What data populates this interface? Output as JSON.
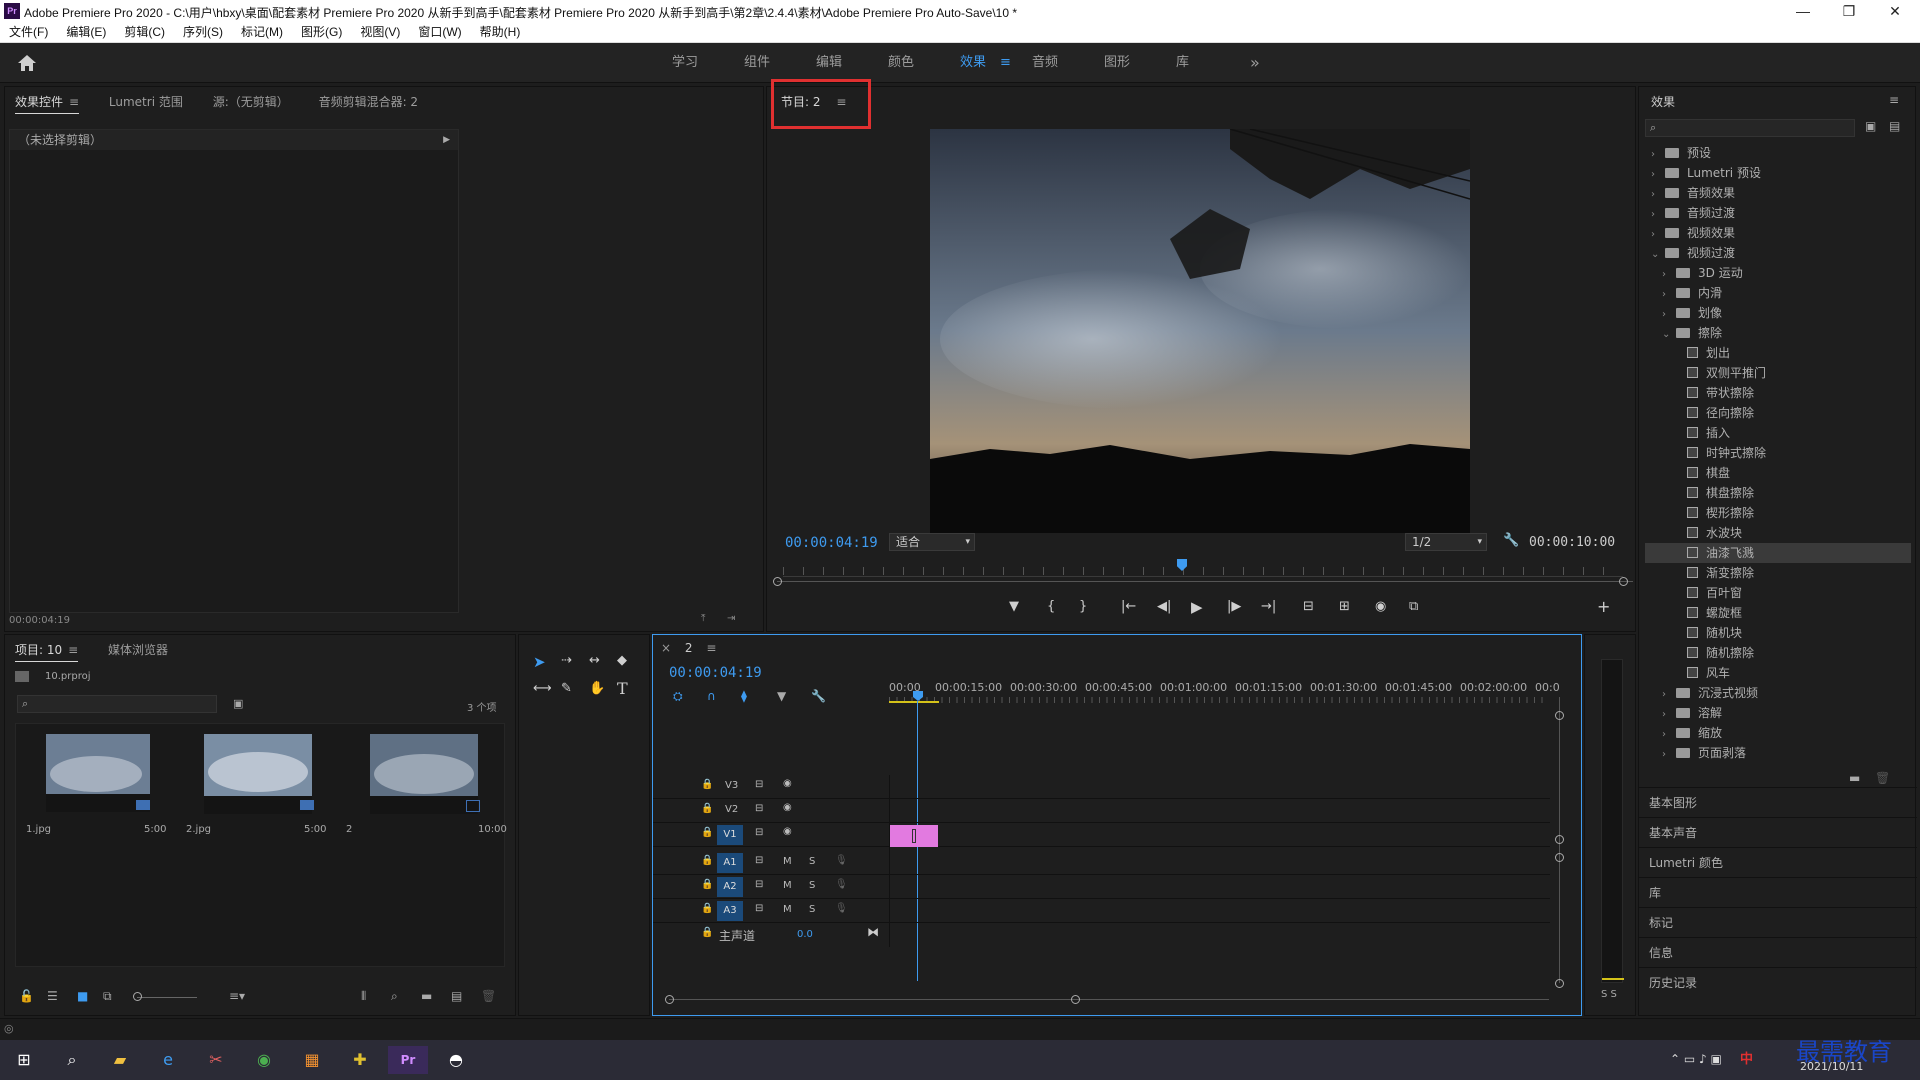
{
  "window": {
    "title": "Adobe Premiere Pro 2020 - C:\\用户\\hbxy\\桌面\\配套素材 Premiere Pro 2020 从新手到高手\\配套素材 Premiere Pro 2020 从新手到高手\\第2章\\2.4.4\\素材\\Adobe Premiere Pro Auto-Save\\10 *",
    "logo": "Pr",
    "minimize": "—",
    "maximize": "❐",
    "close": "✕"
  },
  "menu": [
    "文件(F)",
    "编辑(E)",
    "剪辑(C)",
    "序列(S)",
    "标记(M)",
    "图形(G)",
    "视图(V)",
    "窗口(W)",
    "帮助(H)"
  ],
  "workspaces": {
    "items": [
      "学习",
      "组件",
      "编辑",
      "颜色",
      "效果",
      "音频",
      "图形",
      "库"
    ],
    "active_index": 4,
    "menu_glyph": "≡",
    "more": "»"
  },
  "source_panel": {
    "tabs": [
      "效果控件",
      "Lumetri 范围",
      "源:（无剪辑）",
      "音频剪辑混合器: 2"
    ],
    "menu_glyph": "≡",
    "no_clip": "（未选择剪辑）",
    "timecode": "00:00:04:19"
  },
  "program": {
    "tab": "节目: 2",
    "menu_glyph": "≡",
    "timecode": "00:00:04:19",
    "fit": "适合",
    "resolution": "1/2",
    "duration": "00:00:10:00",
    "playhead_fraction": 0.475,
    "transport": [
      "▼",
      "{",
      "}",
      "|←",
      "◀|",
      "▶",
      "|▶",
      "→|",
      "⊟",
      "⊞",
      "◉",
      "⧉"
    ],
    "add": "+"
  },
  "project": {
    "tabs": [
      "项目: 10",
      "媒体浏览器"
    ],
    "menu_glyph": "≡",
    "file": "10.prproj",
    "count": "3 个项",
    "items": [
      {
        "name": "1.jpg",
        "duration": "5:00"
      },
      {
        "name": "2.jpg",
        "duration": "5:00"
      },
      {
        "name": "2",
        "duration": "10:00"
      }
    ]
  },
  "timeline": {
    "close": "×",
    "tab": "2",
    "menu_glyph": "≡",
    "timecode": "00:00:04:19",
    "ruler": [
      "00:00",
      "00:00:15:00",
      "00:00:30:00",
      "00:00:45:00",
      "00:01:00:00",
      "00:01:15:00",
      "00:01:30:00",
      "00:01:45:00",
      "00:02:00:00",
      "00:0"
    ],
    "video_tracks": [
      "V3",
      "V2",
      "V1"
    ],
    "audio_tracks": [
      "A1",
      "A2",
      "A3"
    ],
    "mute": "M",
    "solo": "S",
    "master": "主声道",
    "master_value": "0.0",
    "clip_color": "#e27ae0"
  },
  "meter": {
    "labels": "S S"
  },
  "effects": {
    "title": "效果",
    "menu_glyph": "≡",
    "search_placeholder": "",
    "tree": [
      {
        "label": "预设",
        "level": 0,
        "type": "folder",
        "open": false
      },
      {
        "label": "Lumetri 预设",
        "level": 0,
        "type": "folder",
        "open": false
      },
      {
        "label": "音频效果",
        "level": 0,
        "type": "folder",
        "open": false
      },
      {
        "label": "音频过渡",
        "level": 0,
        "type": "folder",
        "open": false
      },
      {
        "label": "视频效果",
        "level": 0,
        "type": "folder",
        "open": false
      },
      {
        "label": "视频过渡",
        "level": 0,
        "type": "folder",
        "open": true
      },
      {
        "label": "3D 运动",
        "level": 1,
        "type": "folder",
        "open": false
      },
      {
        "label": "内滑",
        "level": 1,
        "type": "folder",
        "open": false
      },
      {
        "label": "划像",
        "level": 1,
        "type": "folder",
        "open": false
      },
      {
        "label": "擦除",
        "level": 1,
        "type": "folder",
        "open": true
      },
      {
        "label": "划出",
        "level": 2,
        "type": "fx"
      },
      {
        "label": "双侧平推门",
        "level": 2,
        "type": "fx"
      },
      {
        "label": "带状擦除",
        "level": 2,
        "type": "fx"
      },
      {
        "label": "径向擦除",
        "level": 2,
        "type": "fx"
      },
      {
        "label": "插入",
        "level": 2,
        "type": "fx"
      },
      {
        "label": "时钟式擦除",
        "level": 2,
        "type": "fx"
      },
      {
        "label": "棋盘",
        "level": 2,
        "type": "fx"
      },
      {
        "label": "棋盘擦除",
        "level": 2,
        "type": "fx"
      },
      {
        "label": "楔形擦除",
        "level": 2,
        "type": "fx"
      },
      {
        "label": "水波块",
        "level": 2,
        "type": "fx"
      },
      {
        "label": "油漆飞溅",
        "level": 2,
        "type": "fx",
        "selected": true
      },
      {
        "label": "渐变擦除",
        "level": 2,
        "type": "fx"
      },
      {
        "label": "百叶窗",
        "level": 2,
        "type": "fx"
      },
      {
        "label": "螺旋框",
        "level": 2,
        "type": "fx"
      },
      {
        "label": "随机块",
        "level": 2,
        "type": "fx"
      },
      {
        "label": "随机擦除",
        "level": 2,
        "type": "fx"
      },
      {
        "label": "风车",
        "level": 2,
        "type": "fx"
      },
      {
        "label": "沉浸式视频",
        "level": 1,
        "type": "folder",
        "open": false
      },
      {
        "label": "溶解",
        "level": 1,
        "type": "folder",
        "open": false
      },
      {
        "label": "缩放",
        "level": 1,
        "type": "folder",
        "open": false
      },
      {
        "label": "页面剥落",
        "level": 1,
        "type": "folder",
        "open": false
      }
    ],
    "side_panels": [
      "基本图形",
      "基本声音",
      "Lumetri 颜色",
      "库",
      "标记",
      "信息",
      "历史记录"
    ]
  },
  "taskbar": {
    "date": "2021/10/11",
    "ime": "中",
    "watermark": "最需教育"
  },
  "colors": {
    "accent": "#3e9bf0",
    "highlight_box": "#e03030",
    "clip": "#e27ae0"
  }
}
